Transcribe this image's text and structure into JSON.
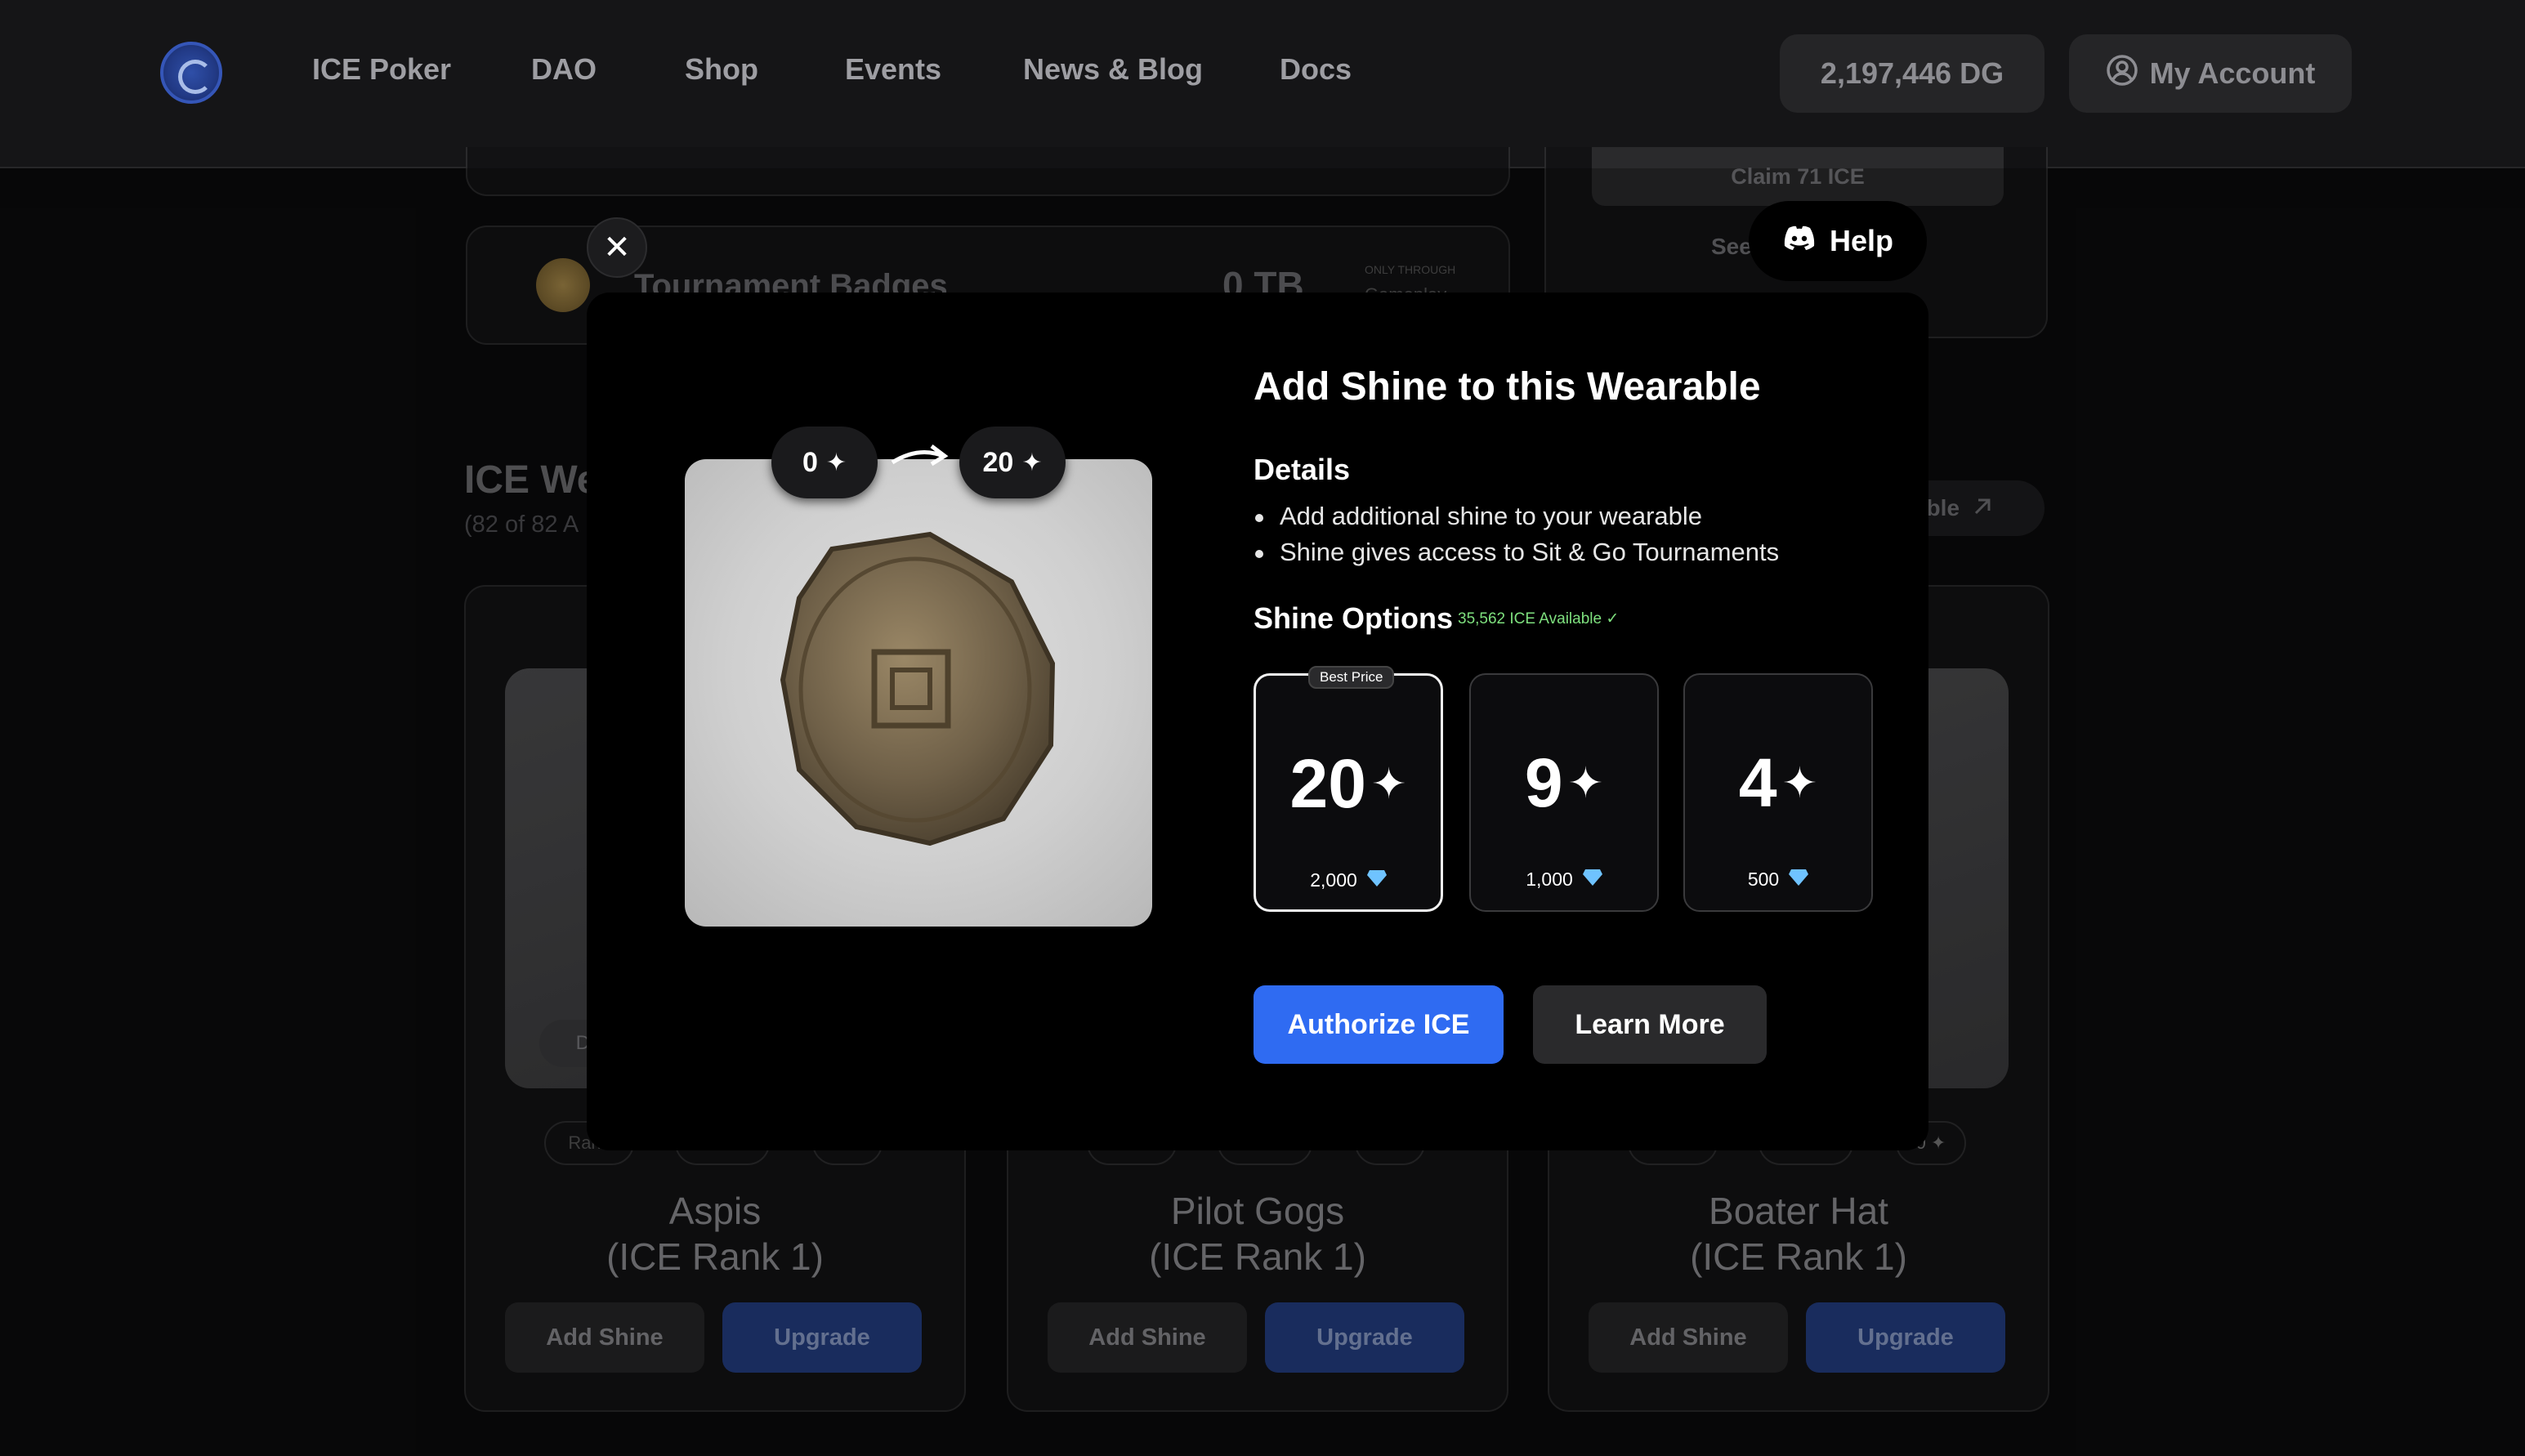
{
  "header": {
    "nav": [
      "ICE Poker",
      "DAO",
      "Shop",
      "Events",
      "News & Blog",
      "Docs"
    ],
    "balance": "2,197,446 DG",
    "account_label": "My Account"
  },
  "background": {
    "claim_label": "Claim 71 ICE",
    "see_label": "See",
    "tournament_badges_label": "Tournament Badges",
    "tournament_badges_value": "0 TB",
    "only_through": "ONLY THROUGH",
    "gameplay": "Gameplay",
    "wearables_title": "ICE We",
    "wearables_count": "(82 of 82 A",
    "marketplace_link": "able",
    "detail_chip": "De",
    "rank_chip": "Rank",
    "shine_chip": "0",
    "cards": [
      {
        "name": "Aspis",
        "rank": "(ICE Rank 1)"
      },
      {
        "name": "Pilot Gogs",
        "rank": "(ICE Rank 1)"
      },
      {
        "name": "Boater Hat",
        "rank": "(ICE Rank 1)"
      }
    ],
    "add_shine_label": "Add Shine",
    "upgrade_label": "Upgrade"
  },
  "modal": {
    "help_label": "Help",
    "current_shine": "0",
    "target_shine": "20",
    "title": "Add Shine to this Wearable",
    "details_heading": "Details",
    "details": [
      "Add additional shine to your wearable",
      "Shine gives access to Sit & Go Tournaments"
    ],
    "options_heading": "Shine Options",
    "available": "35,562 ICE Available ✓",
    "best_price_badge": "Best Price",
    "options": [
      {
        "shine": "20",
        "price": "2,000"
      },
      {
        "shine": "9",
        "price": "1,000"
      },
      {
        "shine": "4",
        "price": "500"
      }
    ],
    "authorize_label": "Authorize ICE",
    "learn_more_label": "Learn More"
  },
  "colors": {
    "accent_blue": "#2f6bf2",
    "diamond_blue": "#6fc3ff",
    "available_green": "#7ee07e"
  }
}
